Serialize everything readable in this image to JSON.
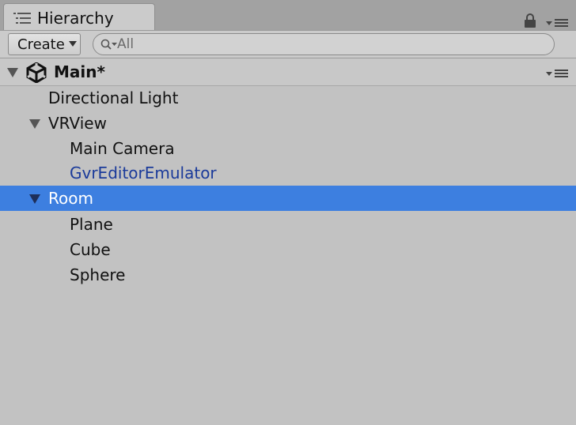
{
  "tab": {
    "title": "Hierarchy",
    "icon": "hierarchy-list-icon"
  },
  "toolbar": {
    "create_label": "Create",
    "search": {
      "value": "",
      "placeholder": "All"
    }
  },
  "scene": {
    "name": "Main*",
    "icon": "unity-logo-icon"
  },
  "tree": [
    {
      "label": "Directional Light",
      "depth": 1,
      "expandable": false
    },
    {
      "label": "VRView",
      "depth": 1,
      "expandable": true,
      "expanded": true
    },
    {
      "label": "Main Camera",
      "depth": 2,
      "expandable": false
    },
    {
      "label": "GvrEditorEmulator",
      "depth": 2,
      "expandable": false,
      "prefab": true
    },
    {
      "label": "Room",
      "depth": 1,
      "expandable": true,
      "expanded": true,
      "selected": true
    },
    {
      "label": "Plane",
      "depth": 2,
      "expandable": false
    },
    {
      "label": "Cube",
      "depth": 2,
      "expandable": false
    },
    {
      "label": "Sphere",
      "depth": 2,
      "expandable": false
    }
  ],
  "colors": {
    "panel_bg": "#c2c2c2",
    "selection": "#3d7fe0",
    "prefab_text": "#1a3a9a"
  }
}
